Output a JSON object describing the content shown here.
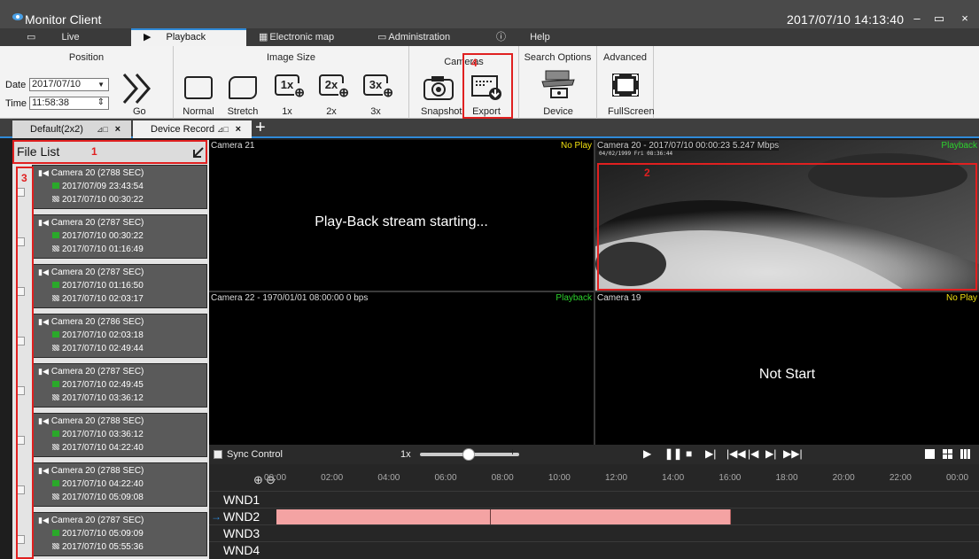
{
  "window": {
    "title": "Monitor Client",
    "clock": "2017/07/10 14:13:40"
  },
  "tabs": [
    {
      "label": "Live"
    },
    {
      "label": "Playback"
    },
    {
      "label": "Electronic map"
    },
    {
      "label": "Administration"
    },
    {
      "label": "Help"
    }
  ],
  "ribbon": {
    "position": {
      "title": "Position",
      "date_label": "Date",
      "date_value": "2017/07/10",
      "time_label": "Time",
      "time_value": "11:58:38",
      "go_label": "Go"
    },
    "image_size": {
      "title": "Image Size",
      "buttons": [
        "Normal",
        "Stretch",
        "1x",
        "2x",
        "3x"
      ],
      "icon_text": [
        "1x",
        "2x",
        "3x"
      ]
    },
    "cameras": {
      "title": "Cameras",
      "buttons": [
        "Snapshot",
        "Export"
      ]
    },
    "search_options": {
      "title": "Search Options",
      "buttons": [
        "Device"
      ]
    },
    "advanced": {
      "title": "Advanced",
      "buttons": [
        "FullScreen"
      ]
    }
  },
  "view_tabs": [
    {
      "label": "Default(2x2)"
    },
    {
      "label": "Device Record"
    }
  ],
  "annotations": [
    "1",
    "2",
    "3",
    "4"
  ],
  "file_list": {
    "title": "File List",
    "records": [
      {
        "camera": "Camera 20  (2788 SEC)",
        "start": "2017/07/09 23:43:54",
        "end": "2017/07/10 00:30:22"
      },
      {
        "camera": "Camera 20  (2787 SEC)",
        "start": "2017/07/10 00:30:22",
        "end": "2017/07/10 01:16:49"
      },
      {
        "camera": "Camera 20  (2787 SEC)",
        "start": "2017/07/10 01:16:50",
        "end": "2017/07/10 02:03:17"
      },
      {
        "camera": "Camera 20  (2786 SEC)",
        "start": "2017/07/10 02:03:18",
        "end": "2017/07/10 02:49:44"
      },
      {
        "camera": "Camera 20  (2787 SEC)",
        "start": "2017/07/10 02:49:45",
        "end": "2017/07/10 03:36:12"
      },
      {
        "camera": "Camera 20  (2788 SEC)",
        "start": "2017/07/10 03:36:12",
        "end": "2017/07/10 04:22:40"
      },
      {
        "camera": "Camera 20  (2788 SEC)",
        "start": "2017/07/10 04:22:40",
        "end": "2017/07/10 05:09:08"
      },
      {
        "camera": "Camera 20  (2787 SEC)",
        "start": "2017/07/10 05:09:09",
        "end": "2017/07/10 05:55:36"
      }
    ]
  },
  "video": {
    "cell1": {
      "caption": "Camera 21",
      "status": "No Play",
      "message": "Play-Back stream starting..."
    },
    "cell2": {
      "caption": "Camera 20 - 2017/07/10 00:00:23  5.247 Mbps",
      "status": "Playback",
      "overlay": "04/02/1999 Fri 08:36:44"
    },
    "cell3": {
      "caption": "Camera 22 - 1970/01/01 08:00:00  0 bps",
      "status": "Playback"
    },
    "cell4": {
      "caption": "Camera 19",
      "status": "No Play",
      "message": "Not Start"
    }
  },
  "timeline": {
    "sync_label": "Sync Control",
    "speed": "1x",
    "hours": [
      "00:00",
      "02:00",
      "04:00",
      "06:00",
      "08:00",
      "10:00",
      "12:00",
      "14:00",
      "16:00",
      "18:00",
      "20:00",
      "22:00",
      "00:00"
    ],
    "windows": [
      "WND1",
      "WND2",
      "WND3",
      "WND4"
    ],
    "wnd2_record_hours": [
      0,
      16
    ]
  },
  "colors": {
    "accent": "#2f8ad8",
    "highlight": "#e02020",
    "record": "#f4a3a3",
    "status_green": "#2dd12d",
    "status_yellow": "#f0e010"
  }
}
